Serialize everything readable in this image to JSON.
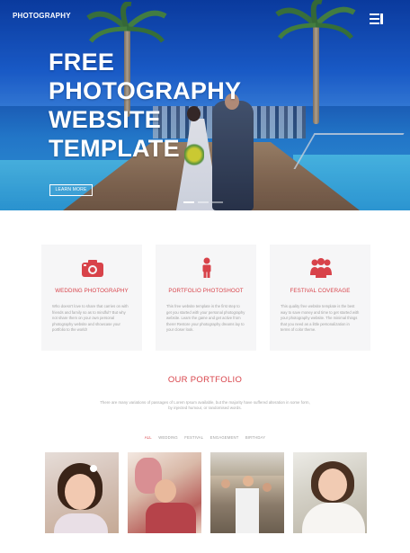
{
  "header": {
    "brand": "PHOTOGRAPHY",
    "menu_icon": "hamburger-icon"
  },
  "hero": {
    "title_lines": [
      "FREE",
      "PHOTOGRAPHY",
      "WEBSITE",
      "TEMPLATE"
    ],
    "button_label": "LEARN MORE",
    "slides": 3,
    "active_slide": 1
  },
  "features": [
    {
      "icon": "camera-icon",
      "title": "WEDDING PHOTOGRAPHY",
      "body": "Who doesn't love to share that carries on with friends and family so as to mindful? But why not share them on your own personal photography website and showcase your portfolio to the world!"
    },
    {
      "icon": "person-icon",
      "title": "PORTFOLIO PHOTOSHOOT",
      "body": "This free website template is the first step to get you started with your personal photography website. Learn the game and get active from there! Restore your photography dreams lay to your closer look."
    },
    {
      "icon": "group-icon",
      "title": "FESTIVAL COVERAGE",
      "body": "This quality free website template is the best way to save money and time to get started with your photography website. The minimal things that you need as a little personalization in terms of color theme."
    }
  ],
  "portfolio": {
    "title": "OUR PORTFOLIO",
    "description": "There are many variations of passages of Lorem Ipsum available, but the majority have suffered alteration in some form, by injected humour, or randomised words.",
    "filters": [
      "ALL",
      "WEDDING",
      "FESTIVAL",
      "ENGAGEMENT",
      "BIRTHDAY"
    ],
    "active_filter": "ALL"
  },
  "colors": {
    "accent": "#d8434a",
    "card_bg": "#f6f6f7"
  }
}
